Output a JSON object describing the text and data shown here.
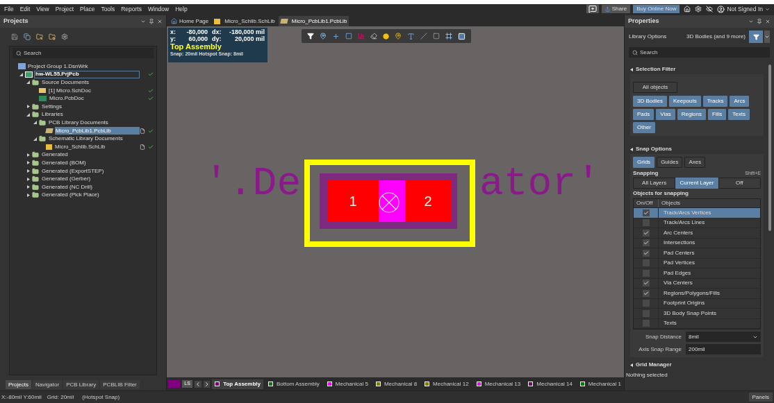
{
  "menu": [
    "File",
    "Edit",
    "View",
    "Project",
    "Place",
    "Tools",
    "Reports",
    "Window",
    "Help"
  ],
  "topbar": {
    "share": "Share",
    "buy": "Buy Online Now",
    "user": "Not Signed In"
  },
  "projects": {
    "title": "Projects",
    "search": {
      "placeholder": "Search"
    },
    "tree": [
      {
        "label": "Project Group 1.DsnWrk",
        "kind": "group",
        "check": false,
        "doc": false,
        "selected": false,
        "children": [
          {
            "label": "hw-WL55.PrjPcb",
            "kind": "project",
            "expanded": true,
            "check": true,
            "doc": false,
            "selected": true,
            "children": [
              {
                "label": "Source Documents",
                "kind": "folder",
                "expanded": true,
                "check": false,
                "doc": false,
                "selected": false,
                "children": [
                  {
                    "label": "[1] Micro.SchDoc",
                    "kind": "schdoc",
                    "check": true,
                    "doc": false,
                    "selected": false
                  },
                  {
                    "label": "Micro.PcbDoc",
                    "kind": "pcbdoc",
                    "check": true,
                    "doc": false,
                    "selected": false
                  }
                ]
              },
              {
                "label": "Settings",
                "kind": "folder",
                "expanded": false,
                "check": false,
                "doc": false,
                "selected": false
              },
              {
                "label": "Libraries",
                "kind": "folder",
                "expanded": true,
                "check": false,
                "doc": false,
                "selected": false,
                "children": [
                  {
                    "label": "PCB Library Documents",
                    "kind": "folder",
                    "expanded": true,
                    "check": false,
                    "doc": false,
                    "selected": false,
                    "children": [
                      {
                        "label": "Micro_PcbLib1.PcbLib",
                        "kind": "pcblib",
                        "check": true,
                        "doc": true,
                        "selected": true
                      }
                    ]
                  },
                  {
                    "label": "Schematic Library Documents",
                    "kind": "folder",
                    "expanded": true,
                    "check": false,
                    "doc": false,
                    "selected": false,
                    "children": [
                      {
                        "label": "Micro_Schlib.SchLib",
                        "kind": "schlib",
                        "check": true,
                        "doc": true,
                        "selected": false
                      }
                    ]
                  }
                ]
              },
              {
                "label": "Generated",
                "kind": "folder",
                "expanded": false,
                "check": false,
                "doc": false,
                "selected": false
              },
              {
                "label": "Generated (BOM)",
                "kind": "folder",
                "expanded": false,
                "check": false,
                "doc": false,
                "selected": false
              },
              {
                "label": "Generated (ExportSTEP)",
                "kind": "folder",
                "expanded": false,
                "check": false,
                "doc": false,
                "selected": false
              },
              {
                "label": "Generated (Gerber)",
                "kind": "folder",
                "expanded": false,
                "check": false,
                "doc": false,
                "selected": false
              },
              {
                "label": "Generated (NC Drill)",
                "kind": "folder",
                "expanded": false,
                "check": false,
                "doc": false,
                "selected": false
              },
              {
                "label": "Generated (Pick Place)",
                "kind": "folder",
                "expanded": false,
                "check": false,
                "doc": false,
                "selected": false
              }
            ]
          }
        ]
      }
    ],
    "tabs": [
      {
        "label": "Projects",
        "selected": true
      },
      {
        "label": "Navigator",
        "selected": false
      },
      {
        "label": "PCB Library",
        "selected": false
      },
      {
        "label": "PCBLIB Filter",
        "selected": false
      }
    ]
  },
  "documents": [
    {
      "label": "Home Page",
      "kind": "home",
      "selected": false
    },
    {
      "label": "Micro_Schlib.SchLib",
      "kind": "schlib",
      "selected": false
    },
    {
      "label": "Micro_PcbLib1.PcbLib",
      "kind": "pcblib",
      "selected": true
    }
  ],
  "coordinates": {
    "rows": [
      {
        "label": "x:",
        "value": "-80,000",
        "delta_label": "dx:",
        "delta": "-180,000 mil"
      },
      {
        "label": "y:",
        "value": "60,000",
        "delta_label": "dy:",
        "delta": "20,000 mil"
      }
    ],
    "layer": "Top Assembly",
    "snap": "Snap: 20mil Hotspot Snap: 8mil"
  },
  "canvas": {
    "designator_left": "'.De",
    "designator_right": "ator'",
    "pads": [
      "1",
      "2"
    ]
  },
  "layers": {
    "ls": "LS",
    "items": [
      {
        "label": "Top Assembly",
        "color": "#800080",
        "selected": true
      },
      {
        "label": "Bottom Assembly",
        "color": "#008000",
        "selected": false
      },
      {
        "label": "Mechanical 5",
        "color": "#ff00ff",
        "selected": false
      },
      {
        "label": "Mechanical 8",
        "color": "#808000",
        "selected": false
      },
      {
        "label": "Mechanical 12",
        "color": "#808000",
        "selected": false
      },
      {
        "label": "Mechanical 13",
        "color": "#ff00ff",
        "selected": false
      },
      {
        "label": "Mechanical 14",
        "color": "#800080",
        "selected": false
      },
      {
        "label": "Mechanical 1",
        "color": "#008000",
        "selected": false
      }
    ]
  },
  "status": [
    "X:-80mil Y:60mil",
    "Grid: 20mil",
    "(Hotspot Snap)"
  ],
  "properties": {
    "title": "Properties",
    "library_options": "Library Options",
    "filter_summary": "3D Bodies (and 9 more)",
    "search": {
      "placeholder": "Search"
    },
    "selection_filter": {
      "title": "Selection Filter",
      "all_objects": {
        "label": "All objects",
        "selected": false
      },
      "filters": [
        {
          "label": "3D Bodies",
          "selected": true
        },
        {
          "label": "Keepouts",
          "selected": true
        },
        {
          "label": "Tracks",
          "selected": true
        },
        {
          "label": "Arcs",
          "selected": true
        },
        {
          "label": "Pads",
          "selected": true
        },
        {
          "label": "Vias",
          "selected": true
        },
        {
          "label": "Regions",
          "selected": true
        },
        {
          "label": "Fills",
          "selected": true
        },
        {
          "label": "Texts",
          "selected": true
        },
        {
          "label": "Other",
          "selected": true
        }
      ]
    },
    "snap_options": {
      "title": "Snap Options",
      "modes": [
        {
          "label": "Grids",
          "selected": true
        },
        {
          "label": "Guides",
          "selected": false
        },
        {
          "label": "Axes",
          "selected": false
        }
      ],
      "snapping": "Snapping",
      "shortcut": "Shift+E",
      "snapping_modes": [
        {
          "label": "All Layers",
          "selected": false
        },
        {
          "label": "Current Layer",
          "selected": true
        },
        {
          "label": "Off",
          "selected": false
        }
      ],
      "objects_title": "Objects for snapping",
      "columns": [
        "On/Off",
        "Objects"
      ],
      "objects": [
        {
          "label": "Track/Arcs Vertices",
          "checked": true,
          "selected": true
        },
        {
          "label": "Track/Arcs Lines",
          "checked": false,
          "selected": false
        },
        {
          "label": "Arc Centers",
          "checked": true,
          "selected": false
        },
        {
          "label": "Intersections",
          "checked": true,
          "selected": false
        },
        {
          "label": "Pad Centers",
          "checked": true,
          "selected": false
        },
        {
          "label": "Pad Vertices",
          "checked": false,
          "selected": false
        },
        {
          "label": "Pad Edges",
          "checked": false,
          "selected": false
        },
        {
          "label": "Via Centers",
          "checked": true,
          "selected": false
        },
        {
          "label": "Regions/Polygons/Fills",
          "checked": true,
          "selected": false
        },
        {
          "label": "Footprint Origins",
          "checked": false,
          "selected": false
        },
        {
          "label": "3D Body Snap Points",
          "checked": false,
          "selected": false
        },
        {
          "label": "Texts",
          "checked": false,
          "selected": false
        }
      ],
      "snap_distance": {
        "label": "Snap Distance",
        "value": "8mil"
      },
      "axis_snap_range": {
        "label": "Axis Snap Range",
        "value": "200mil"
      }
    },
    "grid_manager": "Grid Manager",
    "selection_status": "Nothing selected",
    "panels": "Panels"
  }
}
